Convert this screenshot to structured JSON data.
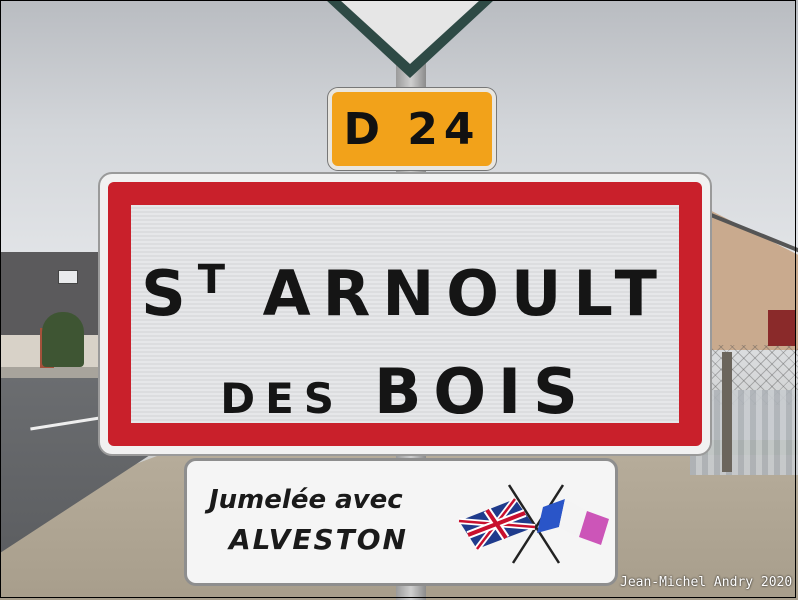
{
  "route_sign": {
    "text": "D 24",
    "color": "#f2a21a"
  },
  "town_sign": {
    "line1_prefix": "S",
    "line1_prefix_sup": "T",
    "line1_main": "ARNOULT",
    "line2_small": "DES",
    "line2_big": "BOIS",
    "border_color": "#c9202b"
  },
  "twin_sign": {
    "line1": "Jumelée avec",
    "line2": "ALVESTON",
    "flags": [
      "union-jack-flag-icon",
      "french-flag-icon"
    ]
  },
  "credit": "Jean-Michel Andry 2020"
}
